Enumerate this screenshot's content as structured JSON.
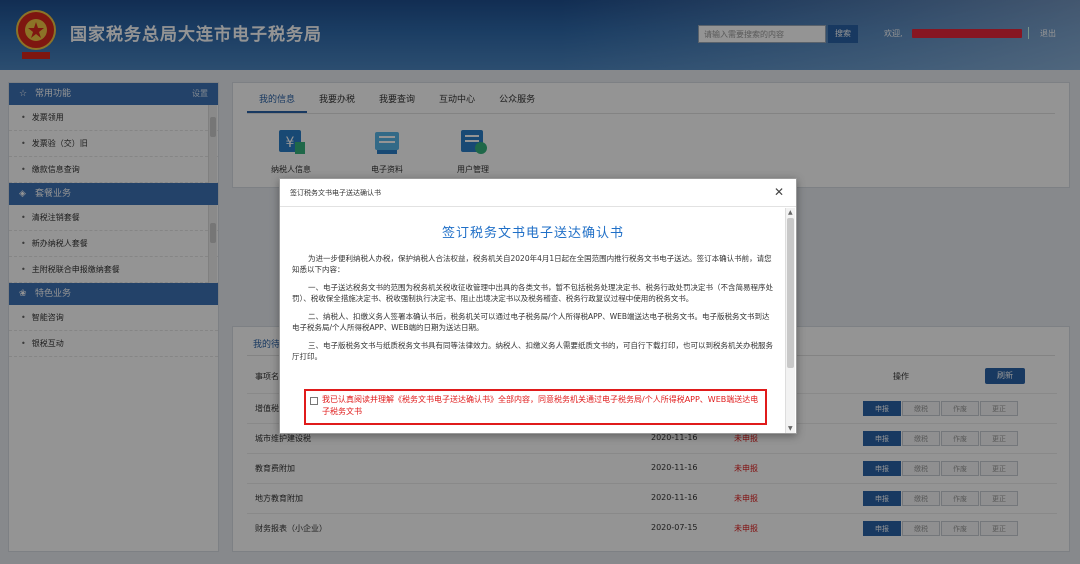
{
  "header": {
    "site_title": "国家税务总局大连市电子税务局",
    "search_placeholder": "请输入需要搜索的内容",
    "search_button": "搜索",
    "welcome": "欢迎,",
    "logout": "退出",
    "brand_red": "#e8263b"
  },
  "sidebar": {
    "sections": [
      {
        "title": "常用功能",
        "right": "设置",
        "icon": "star-icon",
        "items": [
          "发票领用",
          "发票验（交）旧",
          "缴款信息查询"
        ]
      },
      {
        "title": "套餐业务",
        "icon": "shield-icon",
        "items": [
          "清税注销套餐",
          "新办纳税人套餐",
          "主附税联合申报缴纳套餐"
        ]
      },
      {
        "title": "特色业务",
        "icon": "grid-icon",
        "items": [
          "智能咨询",
          "银税互动"
        ]
      }
    ]
  },
  "main": {
    "tabs": [
      "我的信息",
      "我要办税",
      "我要查询",
      "互动中心",
      "公众服务"
    ],
    "tools": [
      {
        "label": "纳税人信息",
        "icon": "taxpayer-info-icon"
      },
      {
        "label": "电子资料",
        "icon": "electronic-docs-icon"
      },
      {
        "label": "用户管理",
        "icon": "user-manage-icon"
      }
    ]
  },
  "lower": {
    "tab": "我的待办",
    "col_item": "事项名称",
    "col_action": "操作",
    "refresh": "刷新",
    "rows": [
      {
        "name": "增值税",
        "date": "",
        "status": ""
      },
      {
        "name": "城市维护建设税",
        "date": "2020-11-16",
        "status": "未申报"
      },
      {
        "name": "教育费附加",
        "date": "2020-11-16",
        "status": "未申报"
      },
      {
        "name": "地方教育附加",
        "date": "2020-11-16",
        "status": "未申报"
      },
      {
        "name": "财务报表（小企业）",
        "date": "2020-07-15",
        "status": "未申报"
      }
    ],
    "buttons": [
      "申报",
      "缴税",
      "作废",
      "更正"
    ]
  },
  "modal": {
    "window_title": "签订税务文书电子送达确认书",
    "heading": "签订税务文书电子送达确认书",
    "paragraphs": [
      "为进一步便利纳税人办税，保护纳税人合法权益，税务机关自2020年4月1日起在全国范围内推行税务文书电子送达。签订本确认书前，请您知悉以下内容：",
      "一、电子送达税务文书的范围为税务机关税收征收管理中出具的各类文书，暂不包括税务处理决定书、税务行政处罚决定书（不含简易程序处罚）、税收保全措施决定书、税收强制执行决定书、阻止出境决定书以及税务稽查、税务行政复议过程中使用的税务文书。",
      "二、纳税人、扣缴义务人签署本确认书后，税务机关可以通过电子税务局/个人所得税APP、WEB端送达电子税务文书。电子版税务文书到达电子税务局/个人所得税APP、WEB端的日期为送达日期。",
      "三、电子版税务文书与纸质税务文书具有同等法律效力。纳税人、扣缴义务人需要纸质文书的，可自行下载打印，也可以到税务机关办税服务厅打印。"
    ],
    "agree_text": "我已认真阅读并理解《税务文书电子送达确认书》全部内容，同意税务机关通过电子税务局/个人所得税APP、WEB端送达电子税务文书",
    "close_icon": "close-icon"
  }
}
